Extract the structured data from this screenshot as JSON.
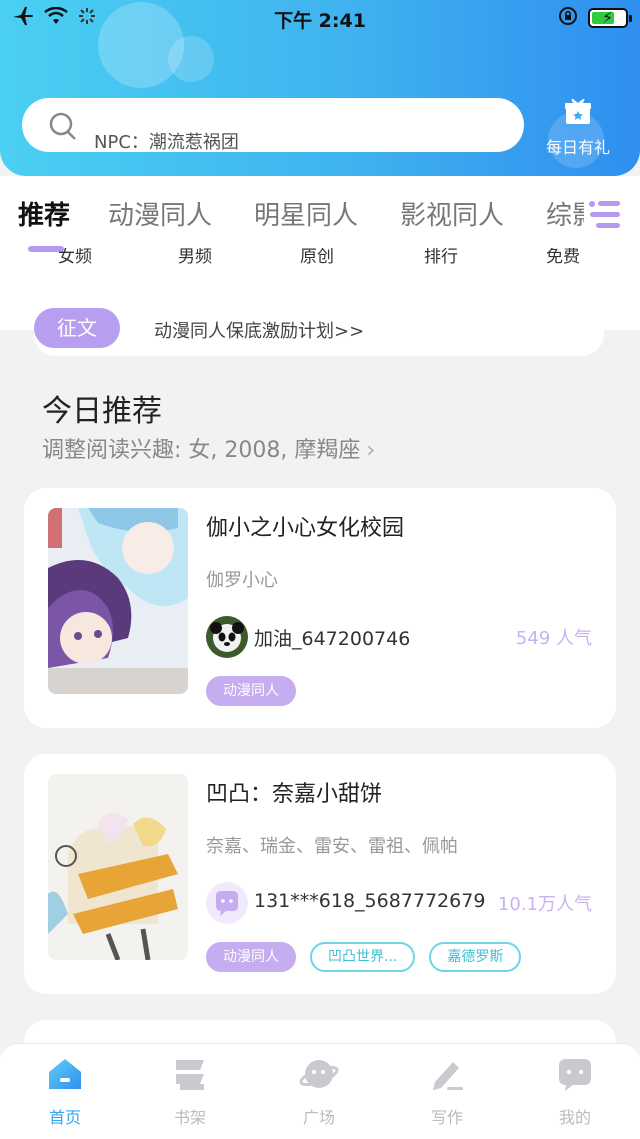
{
  "status_bar": {
    "time": "下午 2:41"
  },
  "header": {
    "search_hint": "NPC：潮流惹祸团",
    "gift_label": "每日有礼"
  },
  "tabs": [
    "推荐",
    "动漫同人",
    "明星同人",
    "影视同人",
    "综影"
  ],
  "active_tab": "推荐",
  "sub_tabs": [
    "女频",
    "男频",
    "原创",
    "排行",
    "免费"
  ],
  "notice": {
    "tag": "征文",
    "text": "动漫同人保底激励计划>>"
  },
  "section": {
    "title": "今日推荐",
    "subtitle": "调整阅读兴趣: 女, 2008, 摩羯座",
    "chevron": "›"
  },
  "cards": [
    {
      "title": "伽小之小心女化校园",
      "author": "伽罗小心",
      "user": "加油_647200746",
      "popularity": "549 人气",
      "chips": [
        {
          "label": "动漫同人",
          "style": "fill"
        }
      ]
    },
    {
      "title": "凹凸：奈嘉小甜饼",
      "author": "奈嘉、瑞金、雷安、雷祖、佩帕",
      "user": "131***618_5687772679",
      "popularity": "10.1万人气",
      "chips": [
        {
          "label": "动漫同人",
          "style": "fill"
        },
        {
          "label": "凹凸世界...",
          "style": "line"
        },
        {
          "label": "嘉德罗斯",
          "style": "line"
        }
      ]
    }
  ],
  "tab_bar": [
    {
      "label": "首页",
      "icon": "home-icon",
      "active": true
    },
    {
      "label": "书架",
      "icon": "bookshelf-icon",
      "active": false
    },
    {
      "label": "广场",
      "icon": "planet-icon",
      "active": false
    },
    {
      "label": "写作",
      "icon": "pen-icon",
      "active": false
    },
    {
      "label": "我的",
      "icon": "chat-bubble-icon",
      "active": false
    }
  ],
  "colors": {
    "accent": "#3aa6ee",
    "purple": "#b89ef0",
    "teal": "#3cc0d6"
  }
}
